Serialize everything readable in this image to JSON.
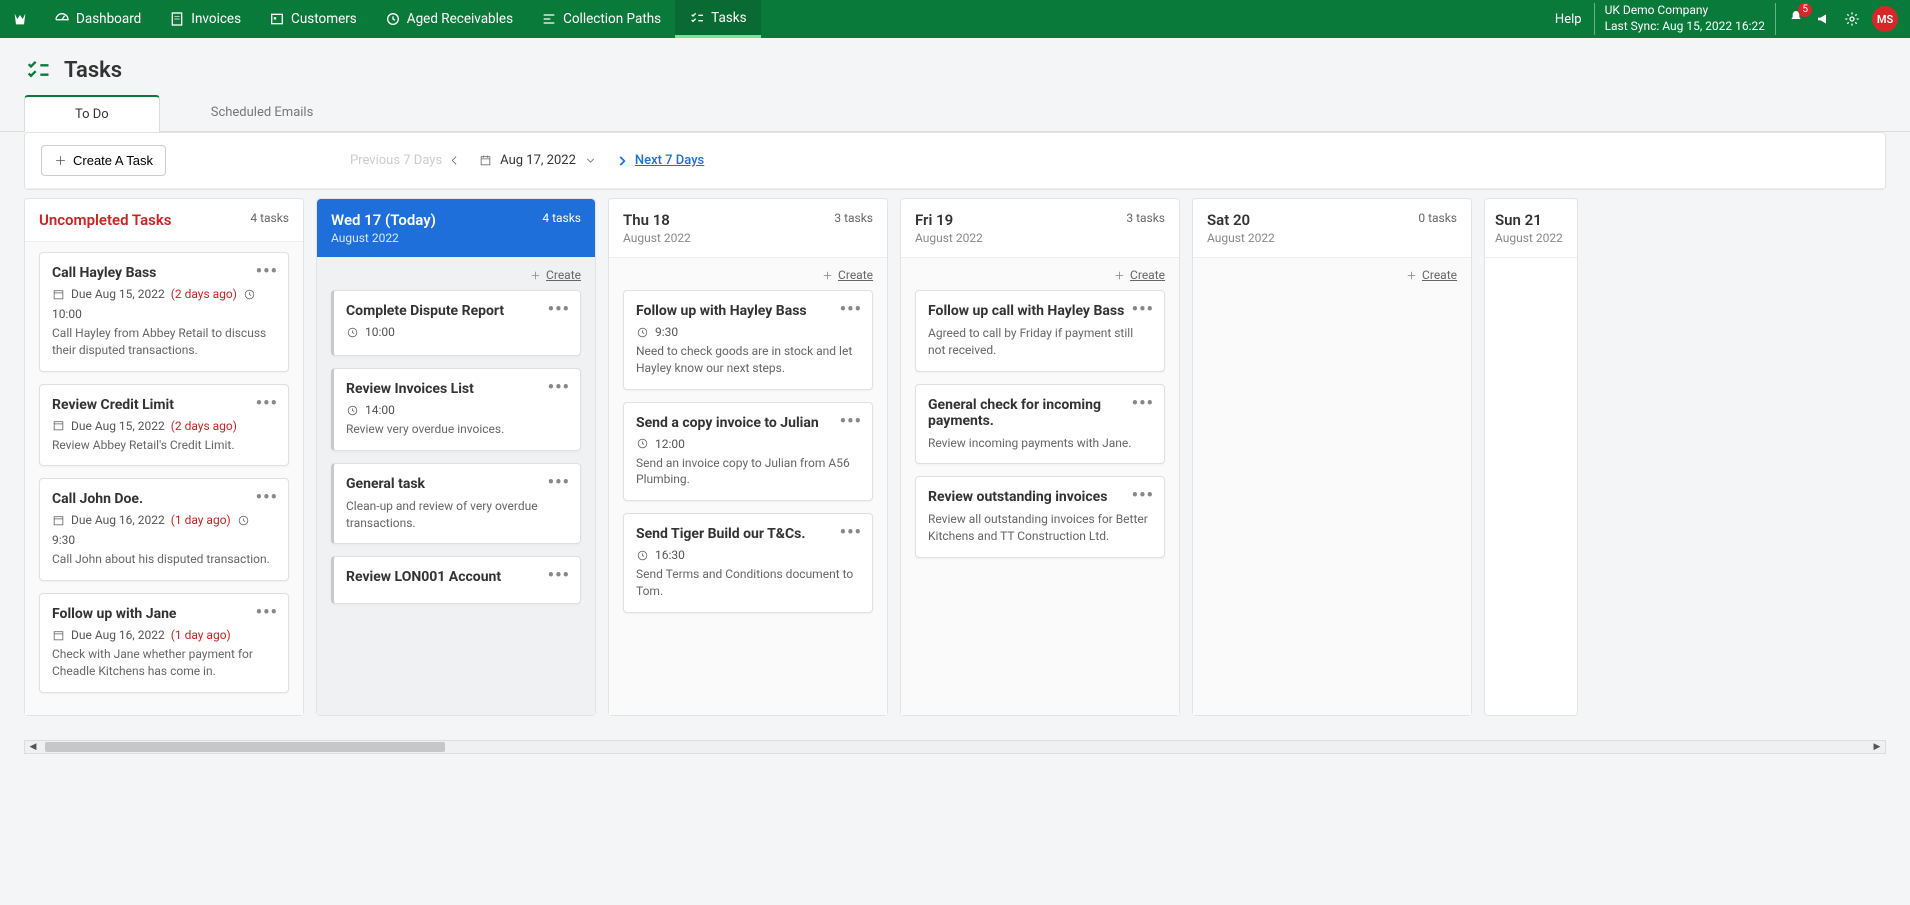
{
  "nav": {
    "items": [
      {
        "label": "Dashboard"
      },
      {
        "label": "Invoices"
      },
      {
        "label": "Customers"
      },
      {
        "label": "Aged Receivables"
      },
      {
        "label": "Collection Paths"
      },
      {
        "label": "Tasks"
      }
    ],
    "help": "Help",
    "company": "UK Demo Company",
    "sync": "Last Sync: Aug 15, 2022 16:22",
    "notif": "5",
    "avatar": "MS"
  },
  "page": {
    "title": "Tasks"
  },
  "tabs": {
    "todo": "To Do",
    "scheduled": "Scheduled Emails"
  },
  "toolbar": {
    "create": "Create A Task",
    "prev": "Previous 7 Days",
    "date": "Aug 17, 2022",
    "next": "Next 7 Days",
    "createLink": "Create"
  },
  "columns": [
    {
      "title": "Uncompleted Tasks",
      "sub": "",
      "count": "4 tasks",
      "kind": "uncompleted",
      "cards": [
        {
          "title": "Call Hayley Bass",
          "due": "Due Aug 15, 2022",
          "ago": "(2 days ago)",
          "time": "10:00",
          "desc": "Call Hayley from Abbey Retail to discuss their disputed transactions."
        },
        {
          "title": "Review Credit Limit",
          "due": "Due Aug 15, 2022",
          "ago": "(2 days ago)",
          "time": "",
          "desc": "Review Abbey Retail's Credit Limit."
        },
        {
          "title": "Call John Doe.",
          "due": "Due Aug 16, 2022",
          "ago": "(1 day ago)",
          "time": "9:30",
          "desc": "Call John about his disputed transaction."
        },
        {
          "title": "Follow up with Jane",
          "due": "Due Aug 16, 2022",
          "ago": "(1 day ago)",
          "time": "",
          "desc": "Check with Jane whether payment for Cheadle Kitchens has come in."
        }
      ]
    },
    {
      "title": "Wed 17 (Today)",
      "sub": "August 2022",
      "count": "4 tasks",
      "kind": "today",
      "cards": [
        {
          "title": "Complete Dispute Report",
          "time": "10:00",
          "desc": ""
        },
        {
          "title": "Review Invoices List",
          "time": "14:00",
          "desc": "Review very overdue invoices."
        },
        {
          "title": "General task",
          "time": "",
          "desc": "Clean-up and review of very overdue transactions."
        },
        {
          "title": "Review LON001 Account",
          "time": "",
          "desc": ""
        }
      ]
    },
    {
      "title": "Thu 18",
      "sub": "August 2022",
      "count": "3 tasks",
      "kind": "day",
      "cards": [
        {
          "title": "Follow up with Hayley Bass",
          "time": "9:30",
          "desc": "Need to check goods are in stock and let Hayley know our next steps."
        },
        {
          "title": "Send a copy invoice to Julian",
          "time": "12:00",
          "desc": "Send an invoice copy to Julian from A56 Plumbing."
        },
        {
          "title": "Send Tiger Build our T&Cs.",
          "time": "16:30",
          "desc": "Send Terms and Conditions document to Tom."
        }
      ]
    },
    {
      "title": "Fri 19",
      "sub": "August 2022",
      "count": "3 tasks",
      "kind": "day",
      "cards": [
        {
          "title": "Follow up call with Hayley Bass",
          "time": "",
          "desc": "Agreed to call by Friday if payment still not received."
        },
        {
          "title": "General check for incoming payments.",
          "time": "",
          "desc": "Review incoming payments with Jane."
        },
        {
          "title": "Review outstanding invoices",
          "time": "",
          "desc": "Review all outstanding invoices for Better Kitchens and TT Construction Ltd."
        }
      ]
    },
    {
      "title": "Sat 20",
      "sub": "August 2022",
      "count": "0 tasks",
      "kind": "day",
      "cards": []
    },
    {
      "title": "Sun 21",
      "sub": "August 2022",
      "count": "",
      "kind": "narrow",
      "cards": []
    }
  ]
}
